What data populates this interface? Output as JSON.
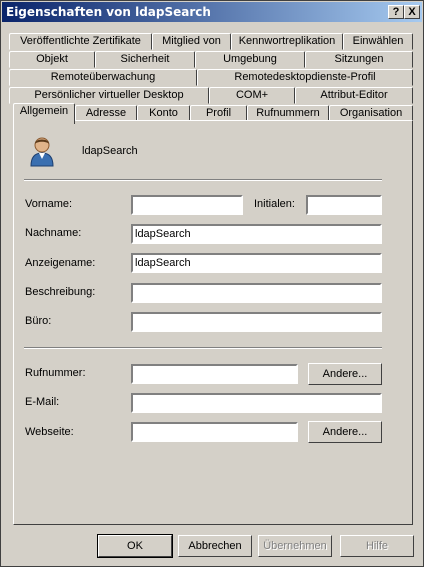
{
  "window": {
    "title": "Eigenschaften von ldapSearch",
    "help_label": "?",
    "close_label": "X"
  },
  "tabs": {
    "row1": [
      "Veröffentlichte Zertifikate",
      "Mitglied von",
      "Kennwortreplikation",
      "Einwählen"
    ],
    "row2": [
      "Objekt",
      "Sicherheit",
      "Umgebung",
      "Sitzungen"
    ],
    "row3": [
      "Remoteüberwachung",
      "Remotedesktopdienste-Profil"
    ],
    "row4": [
      "Persönlicher virtueller Desktop",
      "COM+",
      "Attribut-Editor"
    ],
    "row5": [
      "Allgemein",
      "Adresse",
      "Konto",
      "Profil",
      "Rufnummern",
      "Organisation"
    ],
    "active": "Allgemein"
  },
  "general": {
    "user_icon": "user-icon",
    "display_name": "ldapSearch",
    "fields": {
      "vorname": {
        "label": "Vorname:",
        "value": ""
      },
      "initialen": {
        "label": "Initialen:",
        "value": ""
      },
      "nachname": {
        "label": "Nachname:",
        "value": "ldapSearch"
      },
      "anzeigename": {
        "label": "Anzeigename:",
        "value": "ldapSearch"
      },
      "beschreibung": {
        "label": "Beschreibung:",
        "value": ""
      },
      "buero": {
        "label": "Büro:",
        "value": ""
      },
      "rufnummer": {
        "label": "Rufnummer:",
        "value": ""
      },
      "email": {
        "label": "E-Mail:",
        "value": ""
      },
      "webseite": {
        "label": "Webseite:",
        "value": ""
      }
    },
    "andere_label": "Andere..."
  },
  "footer": {
    "ok": "OK",
    "cancel": "Abbrechen",
    "apply": "Übernehmen",
    "help": "Hilfe"
  }
}
